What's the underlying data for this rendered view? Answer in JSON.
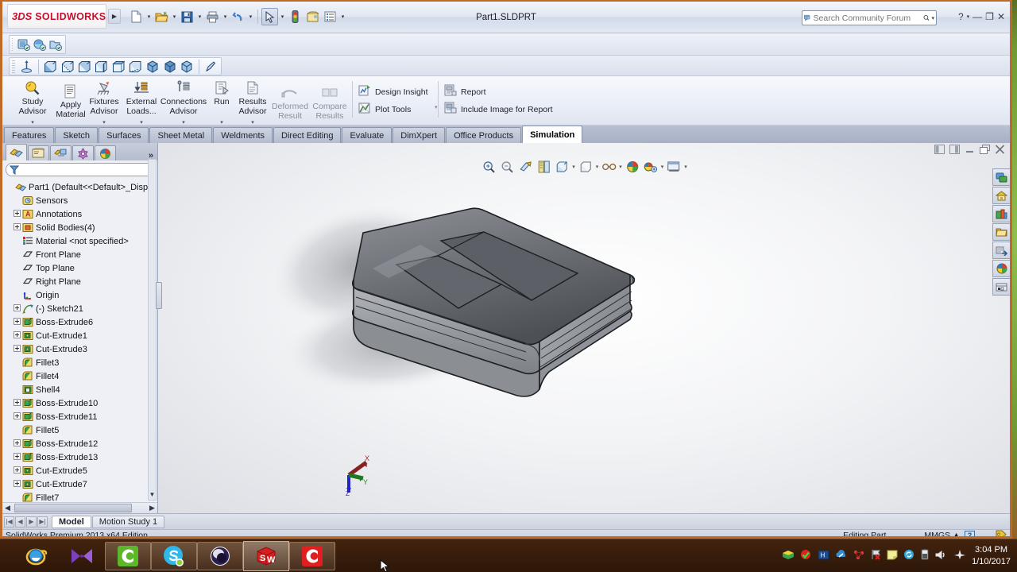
{
  "window": {
    "title": "Part1.SLDPRT",
    "logo_ds": "3DS",
    "logo_name": "SOLIDWORKS",
    "minimize": "—",
    "maximize": "❐",
    "close": "✕",
    "help": "?"
  },
  "search": {
    "placeholder": "Search Community Forum",
    "value": ""
  },
  "main_toolbar": [
    {
      "name": "new-document",
      "icon": "page"
    },
    {
      "name": "open-document",
      "icon": "folder"
    },
    {
      "name": "save-document",
      "icon": "floppy"
    },
    {
      "name": "print-document",
      "icon": "printer"
    },
    {
      "name": "undo",
      "icon": "undo-arrow"
    },
    {
      "name": "select",
      "icon": "cursor-arrow"
    },
    {
      "name": "rebuild",
      "icon": "traffic-light"
    },
    {
      "name": "file-properties",
      "icon": "properties"
    },
    {
      "name": "options",
      "icon": "gear-list"
    }
  ],
  "simulation_strip": [
    {
      "name": "new-study",
      "icon": "study"
    },
    {
      "name": "apply-material-strip",
      "icon": "material"
    },
    {
      "name": "study-properties",
      "icon": "study-props"
    }
  ],
  "view_toolbar": [
    {
      "name": "normal-to",
      "icon": "normal-to"
    },
    {
      "name": "front-view",
      "icon": "cube-front"
    },
    {
      "name": "back-view",
      "icon": "cube-back"
    },
    {
      "name": "left-view",
      "icon": "cube-left"
    },
    {
      "name": "right-view",
      "icon": "cube-right"
    },
    {
      "name": "top-view",
      "icon": "cube-top"
    },
    {
      "name": "bottom-view",
      "icon": "cube-bottom"
    },
    {
      "name": "isometric-view",
      "icon": "cube-iso"
    },
    {
      "name": "trimetric-view",
      "icon": "cube-tri"
    },
    {
      "name": "dimetric-view",
      "icon": "cube-di"
    },
    {
      "name": "view-selector",
      "icon": "pointer-pen"
    }
  ],
  "ribbon": {
    "items": [
      {
        "name": "study-advisor",
        "label": "Study\nAdvisor",
        "icon": "magnifier-ball",
        "dropdown": true
      },
      {
        "name": "apply-material",
        "label": "Apply\nMaterial",
        "icon": "material-list",
        "dropdown": false
      },
      {
        "name": "fixtures-advisor",
        "label": "Fixtures\nAdvisor",
        "icon": "fixture",
        "dropdown": true
      },
      {
        "name": "external-loads-advisor",
        "label": "External\nLoads...",
        "icon": "loads",
        "dropdown": true
      },
      {
        "name": "connections-advisor",
        "label": "Connections\nAdvisor",
        "icon": "connections",
        "dropdown": true
      },
      {
        "name": "run-study",
        "label": "Run",
        "icon": "run",
        "dropdown": true
      },
      {
        "name": "results-advisor",
        "label": "Results\nAdvisor",
        "icon": "results",
        "dropdown": true
      },
      {
        "name": "deformed-result",
        "label": "Deformed\nResult",
        "icon": "deformed",
        "dropdown": false
      },
      {
        "name": "compare-results",
        "label": "Compare\nResults",
        "icon": "compare",
        "dropdown": false
      }
    ],
    "wide_items": [
      {
        "name": "design-insight",
        "label": "Design Insight",
        "icon": "design-insight",
        "dropdown": false
      },
      {
        "name": "plot-tools",
        "label": "Plot Tools",
        "icon": "plot-tools",
        "dropdown": true
      },
      {
        "name": "report",
        "label": "Report",
        "icon": "report",
        "dropdown": false
      },
      {
        "name": "include-image-for-report",
        "label": "Include Image for Report",
        "icon": "report-image",
        "dropdown": false
      }
    ]
  },
  "command_tabs": [
    {
      "name": "tab-features",
      "label": "Features",
      "active": false
    },
    {
      "name": "tab-sketch",
      "label": "Sketch",
      "active": false
    },
    {
      "name": "tab-surfaces",
      "label": "Surfaces",
      "active": false
    },
    {
      "name": "tab-sheet-metal",
      "label": "Sheet Metal",
      "active": false
    },
    {
      "name": "tab-weldments",
      "label": "Weldments",
      "active": false
    },
    {
      "name": "tab-direct-editing",
      "label": "Direct Editing",
      "active": false
    },
    {
      "name": "tab-evaluate",
      "label": "Evaluate",
      "active": false
    },
    {
      "name": "tab-dimxpert",
      "label": "DimXpert",
      "active": false
    },
    {
      "name": "tab-office-products",
      "label": "Office Products",
      "active": false
    },
    {
      "name": "tab-simulation",
      "label": "Simulation",
      "active": true
    }
  ],
  "feature_manager": {
    "tabs": [
      {
        "name": "feature-tree-tab",
        "icon": "feature-tree",
        "active": true
      },
      {
        "name": "property-manager-tab",
        "icon": "property-manager",
        "active": false
      },
      {
        "name": "configuration-manager-tab",
        "icon": "configuration-manager",
        "active": false
      },
      {
        "name": "dimxpert-manager-tab",
        "icon": "dimxpert-manager",
        "active": false
      },
      {
        "name": "display-manager-tab",
        "icon": "display-manager",
        "active": false
      }
    ],
    "expand_chevron": "»",
    "filter_placeholder": "",
    "tree": [
      {
        "label": "Part1  (Default<<Default>_Disp",
        "icon": "part",
        "expander": "",
        "indent": 0,
        "root": true
      },
      {
        "label": "Sensors",
        "icon": "sensors",
        "expander": "",
        "indent": 1
      },
      {
        "label": "Annotations",
        "icon": "annotations",
        "expander": "+",
        "indent": 1
      },
      {
        "label": "Solid Bodies(4)",
        "icon": "solid-bodies",
        "expander": "+",
        "indent": 1
      },
      {
        "label": "Material <not specified>",
        "icon": "material",
        "expander": "",
        "indent": 1
      },
      {
        "label": "Front Plane",
        "icon": "plane",
        "expander": "",
        "indent": 1
      },
      {
        "label": "Top Plane",
        "icon": "plane",
        "expander": "",
        "indent": 1
      },
      {
        "label": "Right Plane",
        "icon": "plane",
        "expander": "",
        "indent": 1
      },
      {
        "label": "Origin",
        "icon": "origin",
        "expander": "",
        "indent": 1
      },
      {
        "label": "(-) Sketch21",
        "icon": "sketch",
        "expander": "+",
        "indent": 1
      },
      {
        "label": "Boss-Extrude6",
        "icon": "boss-extrude",
        "expander": "+",
        "indent": 1
      },
      {
        "label": "Cut-Extrude1",
        "icon": "cut-extrude",
        "expander": "+",
        "indent": 1
      },
      {
        "label": "Cut-Extrude3",
        "icon": "cut-extrude",
        "expander": "+",
        "indent": 1
      },
      {
        "label": "Fillet3",
        "icon": "fillet",
        "expander": "",
        "indent": 1
      },
      {
        "label": "Fillet4",
        "icon": "fillet",
        "expander": "",
        "indent": 1
      },
      {
        "label": "Shell4",
        "icon": "shell",
        "expander": "",
        "indent": 1
      },
      {
        "label": "Boss-Extrude10",
        "icon": "boss-extrude",
        "expander": "+",
        "indent": 1
      },
      {
        "label": "Boss-Extrude11",
        "icon": "boss-extrude",
        "expander": "+",
        "indent": 1
      },
      {
        "label": "Fillet5",
        "icon": "fillet",
        "expander": "",
        "indent": 1
      },
      {
        "label": "Boss-Extrude12",
        "icon": "boss-extrude",
        "expander": "+",
        "indent": 1
      },
      {
        "label": "Boss-Extrude13",
        "icon": "boss-extrude",
        "expander": "+",
        "indent": 1
      },
      {
        "label": "Cut-Extrude5",
        "icon": "cut-extrude",
        "expander": "+",
        "indent": 1
      },
      {
        "label": "Cut-Extrude7",
        "icon": "cut-extrude",
        "expander": "+",
        "indent": 1
      },
      {
        "label": "Fillet7",
        "icon": "fillet",
        "expander": "",
        "indent": 1
      }
    ]
  },
  "viewport": {
    "heads_up": [
      {
        "name": "zoom-to-fit",
        "icon": "zoom-fit",
        "dropdown": false
      },
      {
        "name": "zoom-to-area",
        "icon": "zoom-area",
        "dropdown": false
      },
      {
        "name": "section-view",
        "icon": "section-view",
        "dropdown": false
      },
      {
        "name": "view-orientation",
        "icon": "view-orientation",
        "dropdown": false
      },
      {
        "name": "display-style",
        "icon": "display-style",
        "dropdown": true
      },
      {
        "name": "hide-show-items",
        "icon": "hide-show",
        "dropdown": true
      },
      {
        "name": "edit-appearance",
        "icon": "appearance-glasses",
        "dropdown": true
      },
      {
        "name": "apply-scene",
        "icon": "scene-ball",
        "dropdown": true
      },
      {
        "name": "view-settings",
        "icon": "view-settings",
        "dropdown": true
      },
      {
        "name": "viewport-layout",
        "icon": "viewport-layout",
        "dropdown": true
      }
    ],
    "document_controls": [
      {
        "name": "restore-left-pane",
        "icon": "pane-left"
      },
      {
        "name": "restore-right-pane",
        "icon": "pane-right"
      },
      {
        "name": "minimize-document",
        "icon": "minimize"
      },
      {
        "name": "restore-document",
        "icon": "restore"
      },
      {
        "name": "close-document",
        "icon": "close"
      }
    ],
    "triad": {
      "x": "X",
      "y": "Y",
      "z": "Z"
    },
    "model_name": "enclosure-case-model"
  },
  "task_pane": [
    {
      "name": "solidworks-resources",
      "icon": "resources"
    },
    {
      "name": "design-library",
      "icon": "home"
    },
    {
      "name": "file-explorer",
      "icon": "design-library"
    },
    {
      "name": "view-palette",
      "icon": "folder"
    },
    {
      "name": "appearances-scenes",
      "icon": "search-props"
    },
    {
      "name": "custom-properties",
      "icon": "appearance-ball"
    },
    {
      "name": "solidworks-forum",
      "icon": "flag"
    }
  ],
  "bottom_tabs": {
    "nav": [
      "|◀",
      "◀",
      "▶",
      "▶|"
    ],
    "tabs": [
      {
        "name": "tab-model",
        "label": "Model",
        "active": true
      },
      {
        "name": "tab-motion-study-1",
        "label": "Motion Study 1",
        "active": false
      }
    ]
  },
  "status_bar": {
    "left": "SolidWorks Premium 2013 x64 Edition",
    "editing": "Editing Part",
    "units": "MMGS",
    "units_arrow": "▲",
    "help": "?"
  },
  "taskbar": {
    "apps": [
      {
        "name": "internet-explorer",
        "icon": "ie",
        "state": "pinned"
      },
      {
        "name": "movie-maker",
        "icon": "bowtie",
        "state": "pinned"
      },
      {
        "name": "camtasia-green",
        "icon": "green-c",
        "state": "open"
      },
      {
        "name": "skype",
        "icon": "skype",
        "state": "open"
      },
      {
        "name": "media-player",
        "icon": "orb",
        "state": "open"
      },
      {
        "name": "solidworks",
        "icon": "sw-cube",
        "state": "active"
      },
      {
        "name": "camtasia-red",
        "icon": "red-c",
        "state": "open"
      }
    ],
    "tray": [
      {
        "name": "tray-notepad-icon",
        "icon": "note"
      },
      {
        "name": "tray-antivirus-icon",
        "icon": "shield-check"
      },
      {
        "name": "tray-monitor-icon",
        "icon": "monitor"
      },
      {
        "name": "tray-cloud-icon",
        "icon": "cloud"
      },
      {
        "name": "tray-network-icon",
        "icon": "net"
      },
      {
        "name": "tray-flag-icon",
        "icon": "flag-x"
      },
      {
        "name": "tray-note-icon",
        "icon": "yellow-note"
      },
      {
        "name": "tray-sync-icon",
        "icon": "sync"
      },
      {
        "name": "tray-battery-icon",
        "icon": "battery"
      },
      {
        "name": "tray-volume-icon",
        "icon": "speaker"
      },
      {
        "name": "tray-airplane-icon",
        "icon": "airplane"
      }
    ],
    "time": "3:04 PM",
    "date": "1/10/2017"
  },
  "colors": {
    "brand_red": "#c8102e",
    "window_border": "#c06a28",
    "ribbon_bg": "#eaeef7",
    "accent_blue": "#3d6fb4"
  }
}
